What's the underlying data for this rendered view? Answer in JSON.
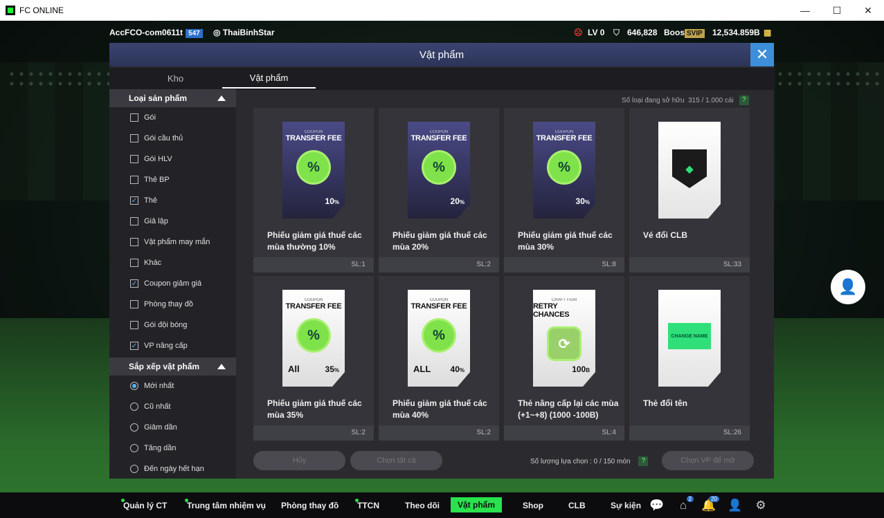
{
  "window": {
    "title": "FC ONLINE"
  },
  "topbar": {
    "account": "AccFCO-com0611t",
    "account_badge": "547",
    "club": "ThaiBinhStar",
    "level": "LV 0",
    "points": "646,828",
    "boost": "Boost",
    "svip": "SVIP",
    "coins": "12,534.859B"
  },
  "modal": {
    "title": "Vật phẩm",
    "tabs": [
      "Kho",
      "Vật phẩm"
    ]
  },
  "sidebar": {
    "product_type_header": "Loại sản phẩm",
    "types": [
      {
        "label": "Gói",
        "checked": false
      },
      {
        "label": "Gói cầu thủ",
        "checked": false
      },
      {
        "label": "Gói HLV",
        "checked": false
      },
      {
        "label": "Thẻ BP",
        "checked": false
      },
      {
        "label": "Thẻ",
        "checked": true
      },
      {
        "label": "Giả lập",
        "checked": false
      },
      {
        "label": "Vật phẩm may mắn",
        "checked": false
      },
      {
        "label": "Khác",
        "checked": false
      },
      {
        "label": "Coupon giảm giá",
        "checked": true
      },
      {
        "label": "Phòng thay đồ",
        "checked": false
      },
      {
        "label": "Gói đội bóng",
        "checked": false
      },
      {
        "label": "VP nâng cấp",
        "checked": true
      }
    ],
    "sort_header": "Sắp xếp vật phẩm",
    "sorts": [
      {
        "label": "Mới nhất",
        "selected": true
      },
      {
        "label": "Cũ nhất",
        "selected": false
      },
      {
        "label": "Giảm dần",
        "selected": false
      },
      {
        "label": "Tăng dần",
        "selected": false
      },
      {
        "label": "Đến ngày hết hạn",
        "selected": false
      }
    ]
  },
  "owned": {
    "label": "Số loại đang sở hữu",
    "value": "315 / 1.000 cái",
    "help": "?"
  },
  "items": [
    {
      "name": "Phiếu giảm giá thuế các mùa thường 10%",
      "qty": "SL:1",
      "coupon": "COUPON",
      "title": "TRANSFER FEE",
      "seal": "%",
      "value": "10",
      "unit": "%",
      "kind": "dark"
    },
    {
      "name": "Phiếu giảm giá thuế các mùa 20%",
      "qty": "SL:2",
      "coupon": "COUPON",
      "title": "TRANSFER FEE",
      "seal": "%",
      "value": "20",
      "unit": "%",
      "kind": "dark"
    },
    {
      "name": "Phiếu giảm giá thuế các mùa 30%",
      "qty": "SL:8",
      "coupon": "COUPON",
      "title": "TRANSFER FEE",
      "seal": "%",
      "value": "30",
      "unit": "%",
      "kind": "dark"
    },
    {
      "name": "Vé đổi CLB",
      "qty": "SL:33",
      "kind": "club"
    },
    {
      "name": "Phiếu giảm giá thuế các mùa 35%",
      "qty": "SL:2",
      "coupon": "COUPON",
      "title": "TRANSFER FEE",
      "seal": "%",
      "value": "35",
      "unit": "%",
      "all": "All",
      "kind": "white"
    },
    {
      "name": "Phiếu giảm giá thuế các mùa 40%",
      "qty": "SL:2",
      "coupon": "COUPON",
      "title": "TRANSFER FEE",
      "seal": "%",
      "value": "40",
      "unit": "%",
      "all": "ALL",
      "kind": "white"
    },
    {
      "name": "Thẻ nâng cấp lại các mùa (+1~+8) (1000 -100B)",
      "qty": "SL:4",
      "coupon": "CRAFT ITEM",
      "title": "RETRY CHANCES",
      "value": "100",
      "unit": "B",
      "kind": "retry"
    },
    {
      "name": "Thẻ đổi tên",
      "qty": "SL:26",
      "change": "CHANGE NAME",
      "kind": "name"
    }
  ],
  "footer": {
    "cancel": "Hủy",
    "select_all": "Chọn tất cả",
    "selected_label": "Số lượng lựa chọn : 0 / 150 món",
    "help": "?",
    "open_btn": "Chọn VP để mở"
  },
  "nav": {
    "items": [
      "Quản lý CT",
      "Trung tâm nhiệm vụ",
      "Phòng thay đồ",
      "TTCN",
      "Theo dõi",
      "Vật phẩm",
      "Shop",
      "CLB",
      "Sự kiện"
    ],
    "badges": {
      "home": "2",
      "bell": "20"
    }
  }
}
